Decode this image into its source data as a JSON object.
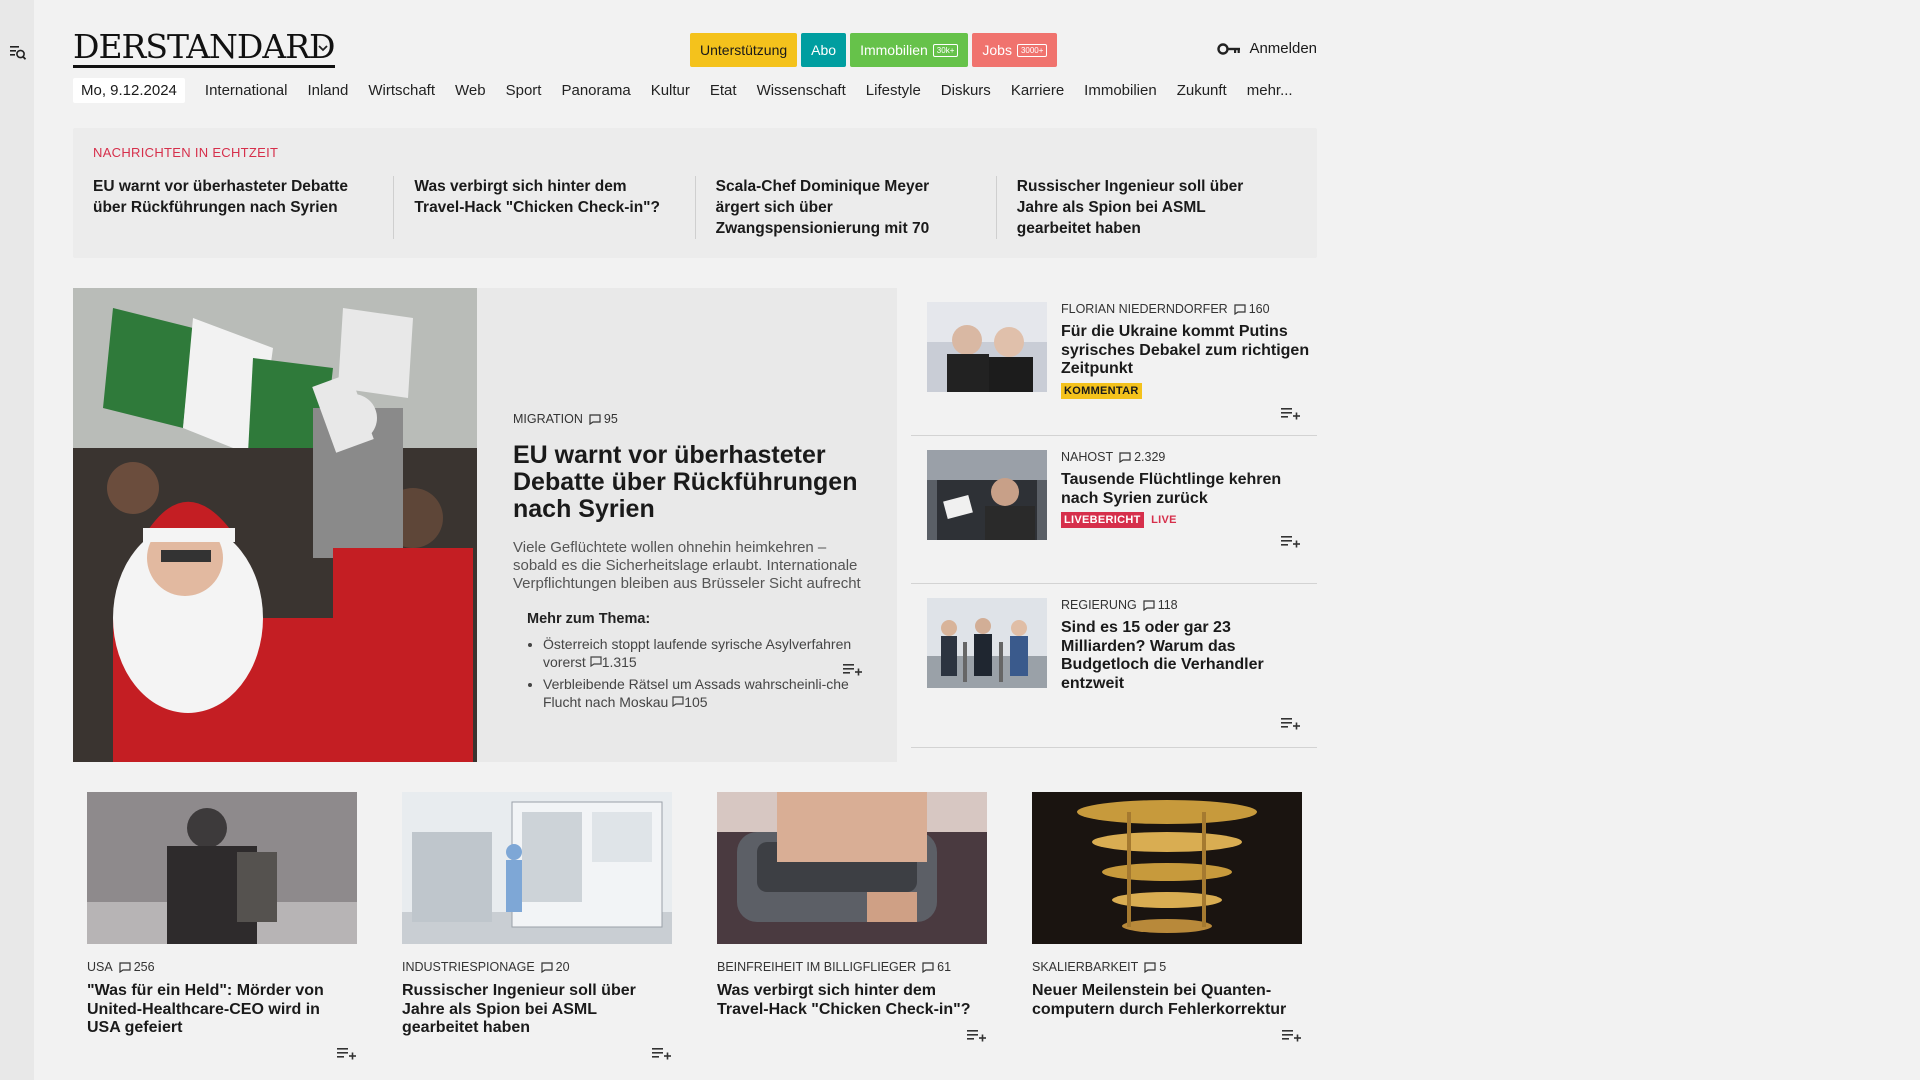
{
  "header": {
    "logo": "DERSTANDARD",
    "pills": [
      {
        "label": "Unterstützung",
        "bg": "#f4c21c",
        "fg": "#1a1a1a",
        "badge": ""
      },
      {
        "label": "Abo",
        "bg": "#009ea0",
        "fg": "#ffffff",
        "badge": ""
      },
      {
        "label": "Immobilien",
        "bg": "#66c24a",
        "fg": "#ffffff",
        "badge": "30k+"
      },
      {
        "label": "Jobs",
        "bg": "#f0736e",
        "fg": "#ffffff",
        "badge": "3000+"
      }
    ],
    "login_label": "Anmelden"
  },
  "nav": {
    "date": "Mo, 9.12.2024",
    "items": [
      "International",
      "Inland",
      "Wirtschaft",
      "Web",
      "Sport",
      "Panorama",
      "Kultur",
      "Etat",
      "Wissenschaft",
      "Lifestyle",
      "Diskurs",
      "Karriere",
      "Immobilien",
      "Zukunft",
      "mehr..."
    ]
  },
  "ticker": {
    "label": "NACHRICHTEN IN ECHTZEIT",
    "items": [
      "EU warnt vor überhasteter Debatte über Rückführungen nach Syrien",
      "Was verbirgt sich hinter dem Travel-Hack \"Chicken Check-in\"?",
      "Scala-Chef Dominique Meyer ärgert sich über Zwangspensionierung mit 70",
      "Russischer Ingenieur soll über Jahre als Spion bei ASML gearbeitet haben"
    ]
  },
  "hero": {
    "kicker": "MIGRATION",
    "comments": "95",
    "title": "EU warnt vor überhasteter Debatte über Rückführungen nach Syrien",
    "teaser": "Viele Geflüchtete wollen ohnehin heimkehren – sobald es die Sicherheitslage erlaubt. Internationale Verpflichtungen bleiben aus Brüsseler Sicht aufrecht",
    "more_label": "Mehr zum Thema:",
    "more": [
      {
        "text": "Österreich stoppt laufende syrische Asylverfahren vorerst",
        "comments": "1.315"
      },
      {
        "text": "Verbleibende Rätsel um Assads wahrscheinli-che Flucht nach Moskau",
        "comments": "105"
      }
    ]
  },
  "side": [
    {
      "kicker": "FLORIAN NIEDERNDORFER",
      "comments": "160",
      "title": "Für die Ukraine kommt Putins syrisches Debakel zum richtigen Zeitpunkt",
      "tag": "KOMMENTAR",
      "tag_bg": "#f4c21c",
      "tag_fg": "#1a1a1a",
      "live": ""
    },
    {
      "kicker": "NAHOST",
      "comments": "2.329",
      "title": "Tausende Flüchtlinge kehren nach Syrien zurück",
      "tag": "LIVEBERICHT",
      "tag_bg": "#d62f4b",
      "tag_fg": "#ffffff",
      "live": "LIVE"
    },
    {
      "kicker": "REGIERUNG",
      "comments": "118",
      "title": "Sind es 15 oder gar 23 Milliarden? Warum das Budgetloch die Verhandler entzweit",
      "tag": "",
      "tag_bg": "",
      "tag_fg": "",
      "live": ""
    }
  ],
  "cards": [
    {
      "kicker": "USA",
      "comments": "256",
      "title": "\"Was für ein Held\": Mörder von United-Healthcare-CEO wird in USA gefeiert"
    },
    {
      "kicker": "INDUSTRIESPIONAGE",
      "comments": "20",
      "title": "Russischer Ingenieur soll über Jahre als Spion bei ASML gearbeitet haben"
    },
    {
      "kicker": "BEINFREIHEIT IM BILLIGFLIEGER",
      "comments": "61",
      "title": "Was verbirgt sich hinter dem Travel-Hack \"Chicken Check-in\"?"
    },
    {
      "kicker": "SKALIERBARKEIT",
      "comments": "5",
      "title": "Neuer Meilenstein bei Quanten-computern durch Fehlerkorrektur"
    }
  ],
  "colors": {
    "accent_red": "#d62f4b",
    "page_bg": "#f2f2f2"
  }
}
